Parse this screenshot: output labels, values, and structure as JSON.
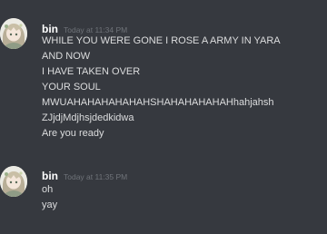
{
  "messages": [
    {
      "username": "bin",
      "timestamp": "Today at 11:34 PM",
      "lines": [
        "WHILE YOU WERE GONE I ROSE A ARMY IN YARA",
        "AND NOW",
        "I HAVE TAKEN OVER",
        "YOUR SOUL",
        "MWUAHAHAHAHAHAHSHAHAHAHAHAHhahjahsh",
        "ZJjdjMdjhsjdedkidwa",
        "Are you ready"
      ]
    },
    {
      "username": "bin",
      "timestamp": "Today at 11:35 PM",
      "lines": [
        "oh",
        "yay"
      ]
    }
  ],
  "colors": {
    "background": "#36393f",
    "username": "#ffffff",
    "timestamp": "#6f7379",
    "message_text": "#dcddde"
  },
  "icons": {
    "avatar": "anime-character-avatar"
  }
}
